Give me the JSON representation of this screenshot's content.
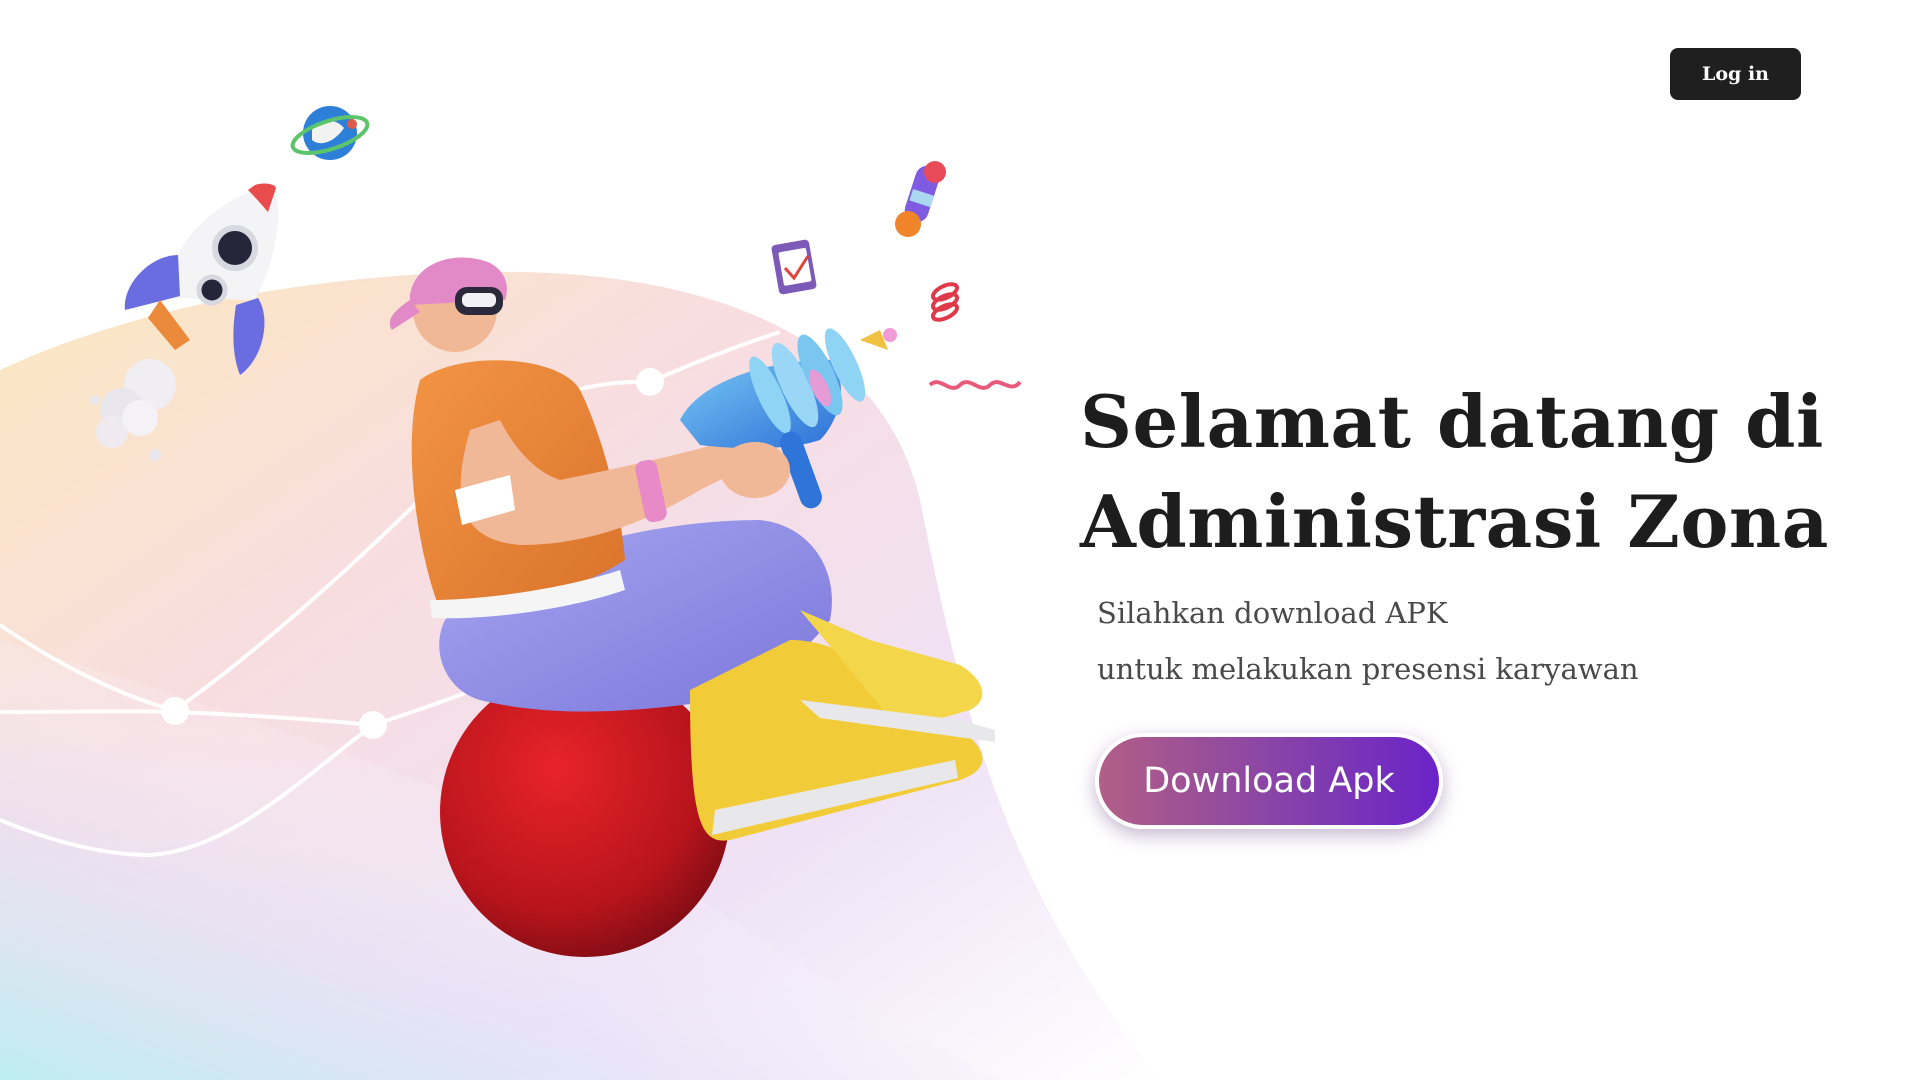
{
  "header": {
    "login_label": "Log in"
  },
  "hero": {
    "title_line1": "Selamat datang di",
    "title_line2": "Administrasi Zona",
    "subtitle_line1": "Silahkan download APK",
    "subtitle_line2": "untuk melakukan presensi karyawan",
    "download_label": "Download Apk"
  },
  "colors": {
    "login_button_bg": "#1f1f1f",
    "download_gradient_start": "#b25e86",
    "download_gradient_end": "#6a23c8",
    "title_text": "#1d1d1d"
  },
  "icons": [
    "globe-icon",
    "rocket-icon",
    "clipboard-icon",
    "lollipop-icon",
    "spring-icon",
    "squiggle-icon"
  ]
}
